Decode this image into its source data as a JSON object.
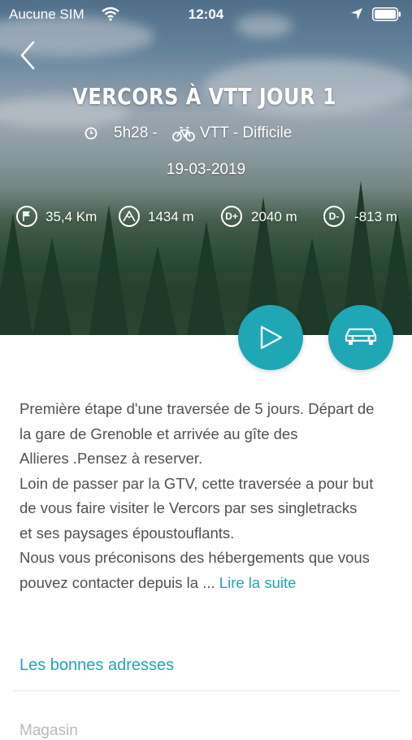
{
  "status_bar": {
    "carrier": "Aucune SIM",
    "time": "12:04"
  },
  "header": {
    "title": "VERCORS À VTT JOUR 1",
    "duration": "5h28 -",
    "activity": "VTT - Difficile",
    "date": "19-03-2019"
  },
  "stats": [
    {
      "icon": "flag-icon",
      "value": "35,4 Km"
    },
    {
      "icon": "mountain-icon",
      "value": "1434 m"
    },
    {
      "icon": "elevation-gain-icon",
      "glyph": "D+",
      "value": "2040 m"
    },
    {
      "icon": "elevation-loss-icon",
      "glyph": "D-",
      "value": "-813 m"
    }
  ],
  "description": {
    "lines": [
      "Première étape d'une traversée de 5 jours. Départ de",
      "la gare de Grenoble et arrivée au gîte des",
      "Allieres .Pensez à reserver.",
      "Loin de passer par la GTV, cette traversée a pour but",
      "de vous faire visiter le Vercors par ses singletracks",
      "et ses paysages époustouflants.",
      "Nous vous préconisons des hébergements que vous",
      "pouvez contacter depuis la ... "
    ],
    "read_more": "Lire la suite"
  },
  "sections": {
    "good_addresses": "Les bonnes adresses",
    "next_item": "Magasin"
  },
  "colors": {
    "accent": "#1fa7b5",
    "text": "#505050"
  }
}
